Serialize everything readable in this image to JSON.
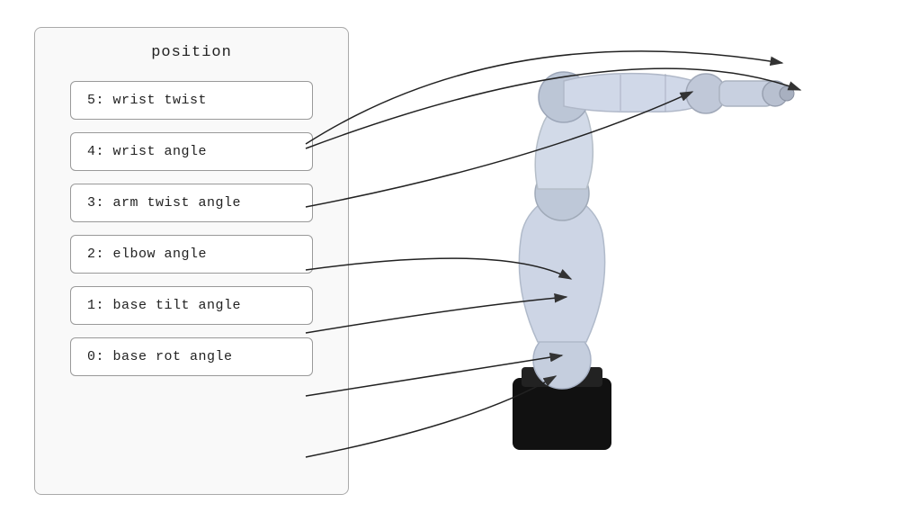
{
  "panel": {
    "title": "position",
    "joints": [
      {
        "id": "joint-5",
        "label": "5: wrist twist"
      },
      {
        "id": "joint-4",
        "label": "4: wrist angle"
      },
      {
        "id": "joint-3",
        "label": "3: arm twist angle"
      },
      {
        "id": "joint-2",
        "label": "2: elbow angle"
      },
      {
        "id": "joint-1",
        "label": "1: base tilt angle"
      },
      {
        "id": "joint-0",
        "label": "0: base rot angle"
      }
    ]
  },
  "arrows": {
    "description": "Lines connecting joint labels to robot parts"
  }
}
